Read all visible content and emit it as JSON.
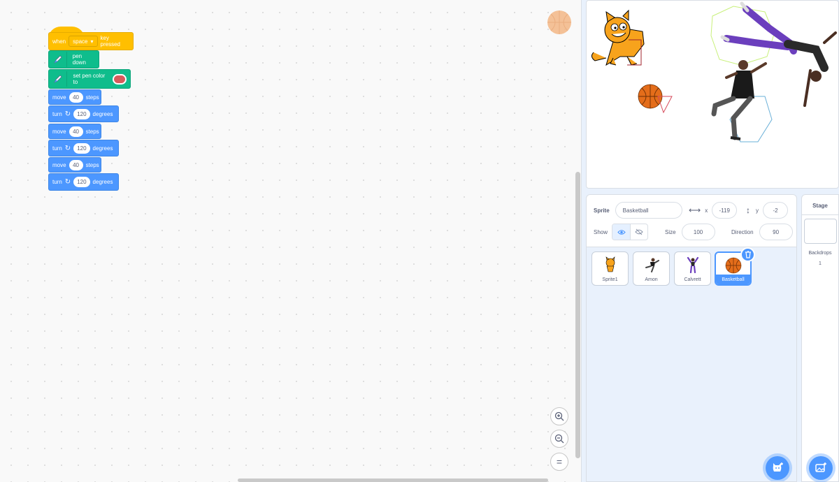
{
  "code": {
    "hat": {
      "when": "when",
      "key": "space",
      "suffix": "key pressed"
    },
    "pen_down": "pen down",
    "set_pen_color": "set pen color to",
    "pen_color": "#d65b5b",
    "move_label": "move",
    "steps_label": "steps",
    "turn_label": "turn",
    "degrees_label": "degrees",
    "moves": [
      "40",
      "40",
      "40"
    ],
    "turns": [
      "120",
      "120",
      "120"
    ]
  },
  "zoom": {
    "in": "+",
    "out": "−",
    "reset": "="
  },
  "sprite_info": {
    "sprite_label": "Sprite",
    "sprite_name": "Basketball",
    "x_label": "x",
    "x_value": "-119",
    "y_label": "y",
    "y_value": "-2",
    "show_label": "Show",
    "size_label": "Size",
    "size_value": "100",
    "direction_label": "Direction",
    "direction_value": "90"
  },
  "sprites": [
    {
      "name": "Sprite1"
    },
    {
      "name": "Amon"
    },
    {
      "name": "Calvrett"
    },
    {
      "name": "Basketball"
    }
  ],
  "stage_pane": {
    "title": "Stage",
    "backdrops_label": "Backdrops",
    "backdrops_count": "1"
  },
  "colors": {
    "events": "#ffbf00",
    "pen": "#0fbd8c",
    "motion": "#4c97ff",
    "accent": "#4c97ff"
  }
}
